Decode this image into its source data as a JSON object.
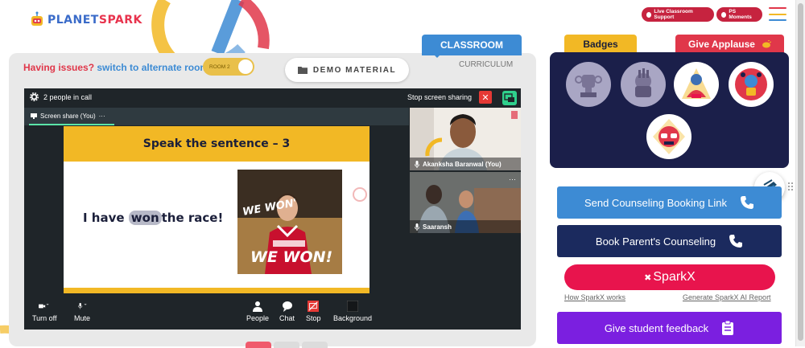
{
  "header": {
    "logo_text_1": "PLANET",
    "logo_text_2": "SPARK",
    "live_support_label": "Live Classroom Support",
    "ps_moments_label": "PS Moments"
  },
  "tabs": {
    "classroom": "CLASSROOM",
    "curriculum": "CURRICULUM",
    "badges": "Badges",
    "give_applause": "Give Applause"
  },
  "room_bar": {
    "issues_text": "Having issues?",
    "alternate_text": "switch to alternate room",
    "room_toggle_label": "ROOM 2",
    "demo_material_label": "DEMO MATERIAL"
  },
  "call": {
    "people_count": "2 people in call",
    "stop_sharing_label": "Stop screen sharing",
    "screen_share_tab": "Screen share (You)",
    "participants": [
      {
        "name": "Akanksha Baranwal (You)"
      },
      {
        "name": "Saaransh"
      }
    ],
    "controls": {
      "turn_off": "Turn off",
      "mute": "Mute",
      "people": "People",
      "chat": "Chat",
      "stop": "Stop",
      "background": "Background"
    }
  },
  "slide": {
    "title": "Speak the sentence – 3",
    "sentence_pre": "I have",
    "sentence_word": "won",
    "sentence_post": "the race!",
    "gif_text_top": "WE WON'",
    "gif_text_bottom": "WE WON!"
  },
  "side_actions": {
    "counseling_link": "Send Counseling Booking Link",
    "parent_counseling": "Book Parent's Counseling",
    "sparkx": "SparkX",
    "how_sparkx": "How SparkX works",
    "generate_report": "Generate SparkX AI Report",
    "student_feedback": "Give student feedback"
  },
  "colors": {
    "brand_red": "#e0374a",
    "brand_blue": "#3d8bd4",
    "navy": "#1b1f4a",
    "yellow": "#f2b825",
    "purple": "#7b1fe0",
    "sparkx_pink": "#e8144d"
  }
}
